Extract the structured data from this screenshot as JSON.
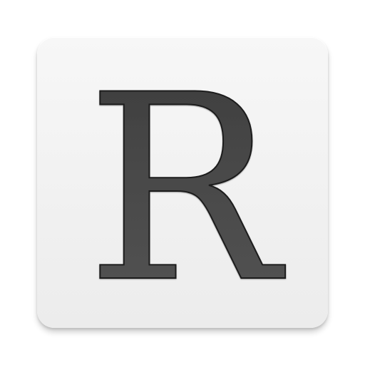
{
  "app_icon": {
    "letter": "R",
    "icon_name": "letter-r-icon",
    "colors": {
      "tile_background": "#f2f2f2",
      "letter_fill": "#4a4a4a",
      "letter_outline": "#1e1e1e"
    }
  }
}
